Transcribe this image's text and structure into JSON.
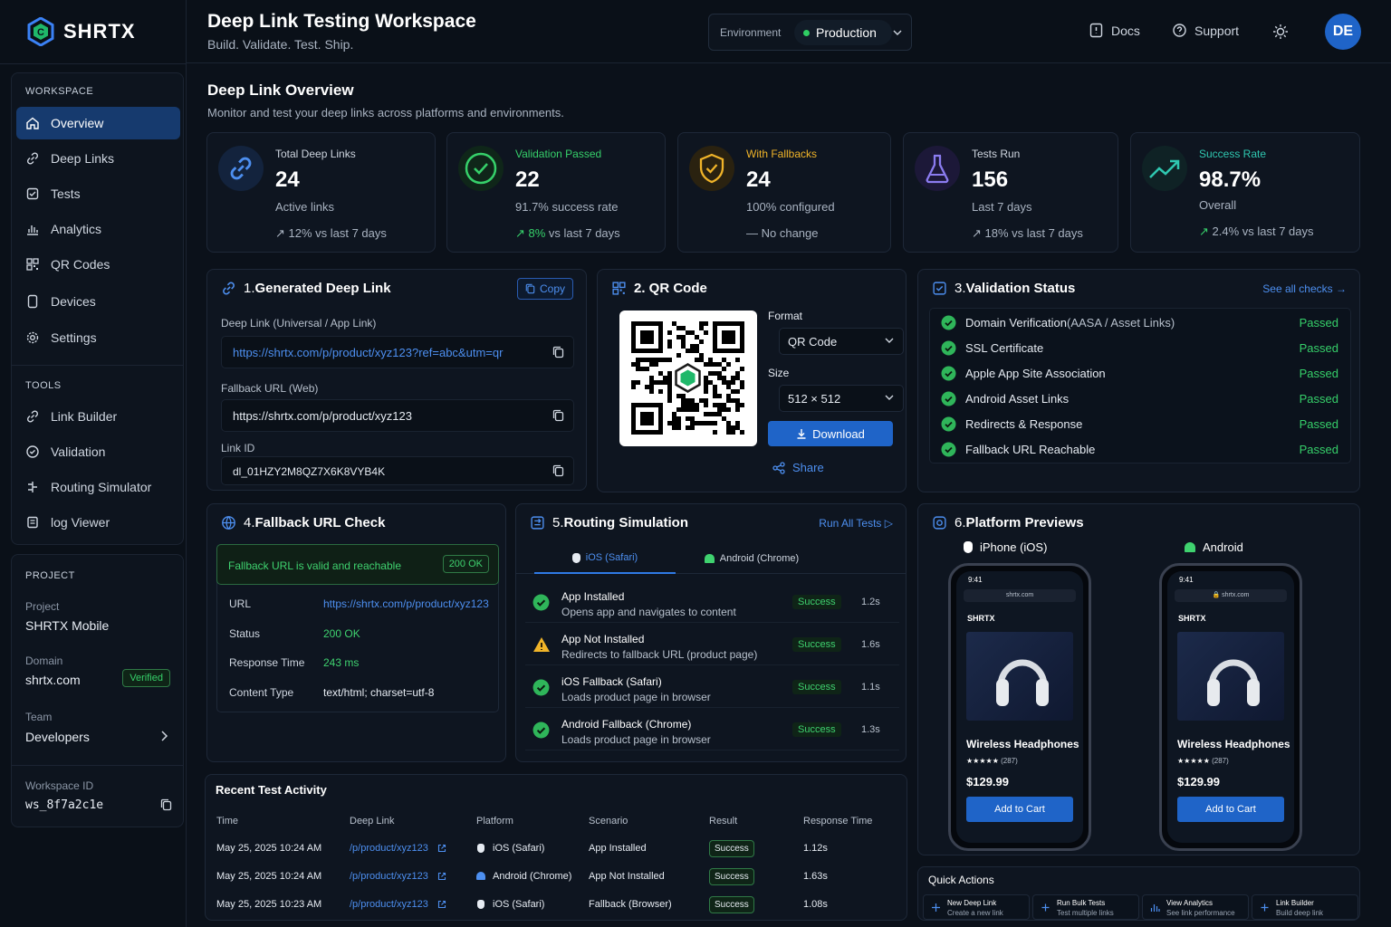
{
  "app": {
    "name": "SHRTX"
  },
  "header": {
    "title": "Deep Link Testing Workspace",
    "subtitle": "Build. Validate. Test. Ship.",
    "env_label": "Environment",
    "env_value": "Production",
    "docs": "Docs",
    "support": "Support",
    "avatar": "DE"
  },
  "sidebar": {
    "workspace_head": "WORKSPACE",
    "items": [
      {
        "label": "Overview",
        "icon": "home-icon",
        "active": true
      },
      {
        "label": "Deep Links",
        "icon": "link-icon"
      },
      {
        "label": "Tests",
        "icon": "checklist-icon"
      },
      {
        "label": "Analytics",
        "icon": "bar-chart-icon"
      },
      {
        "label": "QR Codes",
        "icon": "qr-icon"
      },
      {
        "label": "Devices",
        "icon": "device-icon"
      },
      {
        "label": "Settings",
        "icon": "gear-icon"
      }
    ],
    "tools_head": "TOOLS",
    "tools": [
      {
        "label": "Link Builder",
        "icon": "link-icon"
      },
      {
        "label": "Validation",
        "icon": "check-circle-icon"
      },
      {
        "label": "Routing Simulator",
        "icon": "route-icon"
      },
      {
        "label": "log Viewer",
        "icon": "log-icon"
      }
    ],
    "project_head": "PROJECT",
    "project_label": "Project",
    "project_value": "SHRTX Mobile",
    "domain_label": "Domain",
    "domain_value": "shrtx.com",
    "domain_badge": "Verified",
    "team_label": "Team",
    "team_value": "Developers",
    "workspace_id_label": "Workspace ID",
    "workspace_id_value": "ws_8f7a2c1e"
  },
  "overview": {
    "title": "Deep Link Overview",
    "subtitle": "Monitor and test your deep links across platforms and environments."
  },
  "stats": [
    {
      "title": "Total Deep Links",
      "value": "24",
      "sub": "Active links",
      "delta": "↗ 12% vs last 7 days",
      "color": "#4d8ff0"
    },
    {
      "title": "Validation Passed",
      "value": "22",
      "sub": "91.7% success rate",
      "delta_hl": "↗ 8%",
      "delta": " vs last 7 days",
      "color": "#36d06a"
    },
    {
      "title": "With Fallbacks",
      "value": "24",
      "sub": "100% configured",
      "delta": "— No change",
      "color": "#f0b429"
    },
    {
      "title": "Tests Run",
      "value": "156",
      "sub": "Last 7 days",
      "delta": "↗ 18% vs last 7 days",
      "color": "#8b7cf0"
    },
    {
      "title": "Success Rate",
      "value": "98.7%",
      "sub": "Overall",
      "delta_hl": "↗",
      "delta": " 2.4% vs last 7 days",
      "color": "#2fc7b0"
    }
  ],
  "generated": {
    "num": "1.",
    "title": "Generated Deep Link",
    "copy": "Copy",
    "deep_label": "Deep Link (Universal / App Link)",
    "deep_value": "https://shrtx.com/p/product/xyz123?ref=abc&utm=qr",
    "fallback_label": "Fallback URL (Web)",
    "fallback_value": "https://shrtx.com/p/product/xyz123",
    "id_label": "Link ID",
    "id_value": "dl_01HZY2M8QZ7X6K8VYB4K"
  },
  "qr": {
    "title": "2. QR Code",
    "format_label": "Format",
    "format_value": "QR Code",
    "size_label": "Size",
    "size_value": "512 × 512",
    "download": "Download",
    "share": "Share"
  },
  "validation": {
    "num": "3.",
    "title": "Validation Status",
    "see_all": "See all checks →",
    "checks": [
      {
        "label": "Domain Verification",
        "extra": " (AASA / Asset Links)",
        "result": "Passed"
      },
      {
        "label": "SSL Certificate",
        "extra": "",
        "result": "Passed"
      },
      {
        "label": "Apple App Site Association",
        "extra": "",
        "result": "Passed"
      },
      {
        "label": "Android Asset Links",
        "extra": "",
        "result": "Passed"
      },
      {
        "label": "Redirects & Response",
        "extra": "",
        "result": "Passed"
      },
      {
        "label": "Fallback URL Reachable",
        "extra": "",
        "result": "Passed"
      }
    ]
  },
  "fallback": {
    "num": "4.",
    "title": "Fallback URL Check",
    "banner": "Fallback URL is valid and reachable",
    "banner_badge": "200 OK",
    "url_label": "URL",
    "url_value": "https://shrtx.com/p/product/xyz123",
    "status_label": "Status",
    "status_value": "200 OK",
    "rt_label": "Response Time",
    "rt_value": "243 ms",
    "ct_label": "Content Type",
    "ct_value": "text/html; charset=utf-8"
  },
  "routing": {
    "num": "5.",
    "title": "Routing Simulation",
    "run_all": "Run All Tests ▷",
    "tab_ios": "iOS (Safari)",
    "tab_android": "Android (Chrome)",
    "rows": [
      {
        "title": "App Installed",
        "desc": "Opens app and navigates to content",
        "status": "Success",
        "time": "1.2s",
        "icon": "success"
      },
      {
        "title": "App Not Installed",
        "desc": "Redirects to fallback URL (product page)",
        "status": "Success",
        "time": "1.6s",
        "icon": "warning"
      },
      {
        "title": "iOS Fallback (Safari)",
        "desc": "Loads product page in browser",
        "status": "Success",
        "time": "1.1s",
        "icon": "success"
      },
      {
        "title": "Android Fallback (Chrome)",
        "desc": "Loads product page in browser",
        "status": "Success",
        "time": "1.3s",
        "icon": "success"
      }
    ]
  },
  "previews": {
    "num": "6.",
    "title": "Platform Previews",
    "ios_label": "iPhone (iOS)",
    "android_label": "Android",
    "phone": {
      "time": "9:41",
      "url": "shrtx.com",
      "android_url": "🔒 shrtx.com",
      "brand": "SHRTX",
      "product": "Wireless Headphones",
      "stars": "★★★★★",
      "reviews": "(287)",
      "price": "$129.99",
      "cta": "Add to Cart"
    }
  },
  "recent": {
    "title": "Recent Test Activity",
    "headers": [
      "Time",
      "Deep Link",
      "Platform",
      "Scenario",
      "Result",
      "Response Time"
    ],
    "rows": [
      {
        "time": "May 25, 2025  10:24 AM",
        "link": "/p/product/xyz123",
        "platform": "iOS (Safari)",
        "scenario": "App Installed",
        "result": "Success",
        "rt": "1.12s"
      },
      {
        "time": "May 25, 2025  10:24 AM",
        "link": "/p/product/xyz123",
        "platform": "Android (Chrome)",
        "scenario": "App Not Installed",
        "result": "Success",
        "rt": "1.63s"
      },
      {
        "time": "May 25, 2025  10:23 AM",
        "link": "/p/product/xyz123",
        "platform": "iOS (Safari)",
        "scenario": "Fallback (Browser)",
        "result": "Success",
        "rt": "1.08s"
      }
    ]
  },
  "quick": {
    "title": "Quick Actions",
    "items": [
      {
        "title": "New Deep Link",
        "desc": "Create a new link"
      },
      {
        "title": "Run Bulk Tests",
        "desc": "Test multiple links"
      },
      {
        "title": "View Analytics",
        "desc": "See link performance"
      },
      {
        "title": "Link Builder",
        "desc": "Build deep link"
      }
    ]
  }
}
